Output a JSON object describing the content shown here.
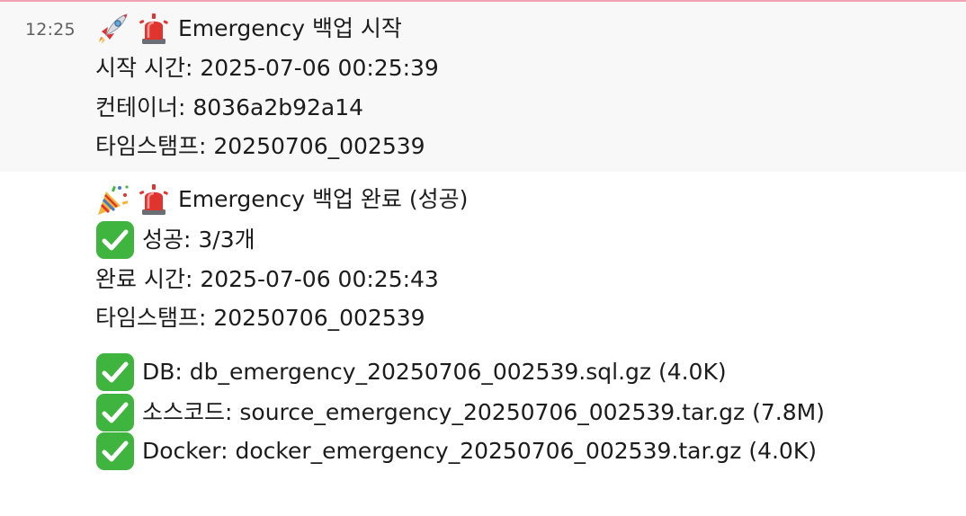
{
  "message_start": {
    "time": "12:25",
    "title": "Emergency 백업 시작",
    "start_time": "시작 시간: 2025-07-06 00:25:39",
    "container": "컨테이너: 8036a2b92a14",
    "timestamp": "타임스탬프: 20250706_002539",
    "icons": [
      "rocket-icon",
      "rotating-light-icon"
    ]
  },
  "message_done": {
    "title": "Emergency 백업 완료 (성공)",
    "success": "성공: 3/3개",
    "done_time": "완료 시간: 2025-07-06 00:25:43",
    "timestamp": "타임스탬프: 20250706_002539",
    "files": [
      "DB: db_emergency_20250706_002539.sql.gz (4.0K)",
      "소스코드: source_emergency_20250706_002539.tar.gz (7.8M)",
      "Docker: docker_emergency_20250706_002539.tar.gz (4.0K)"
    ],
    "icons": [
      "party-popper-icon",
      "rotating-light-icon",
      "check-mark-button-icon"
    ]
  },
  "colors": {
    "highlight_bg": "#f8f8f8",
    "top_rule": "#f0a3b4",
    "text": "#1d1c1d",
    "timestamp": "#616061",
    "check_green": "#3fb53f"
  }
}
